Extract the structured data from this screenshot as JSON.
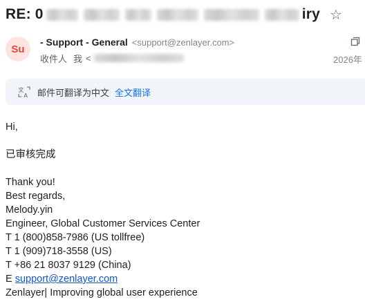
{
  "subject": {
    "prefix": "RE: 0",
    "suffix": "iry",
    "star_icon": "star-outline-icon",
    "star_glyph": "☆"
  },
  "sender": {
    "avatar_initials": "Su",
    "avatar_bg": "#fde4e0",
    "avatar_fg": "#e8453c",
    "name": "- Support - General",
    "email": "<support@zenlayer.com>",
    "recipients_label": "收件人",
    "recipient_me": "我",
    "recipient_open": "<",
    "date": "2026年"
  },
  "translate_banner": {
    "icon": "translate-icon",
    "message": "邮件可翻译为中文",
    "action_label": "全文翻译"
  },
  "body": {
    "greeting": "Hi,",
    "line_approved": "已审核完成",
    "thanks": "Thank you!",
    "regards": "Best regards,",
    "name": "Melody.yin",
    "title": "Engineer, Global Customer Services Center",
    "phone_us_tollfree": "T 1 (800)858-7986 (US tollfree)",
    "phone_us": "T 1 (909)718-3558 (US)",
    "phone_china": "T +86 21 8037 9129 (China)",
    "email_prefix": "E ",
    "email_link": "support@zenlayer.com",
    "tagline": "Zenlayer| Improving global user experience"
  },
  "colors": {
    "link": "#1155cc",
    "action_link": "#1a73e8",
    "banner_bg": "#f1f5f9",
    "text": "#1f1f1f",
    "muted": "#80868b"
  }
}
